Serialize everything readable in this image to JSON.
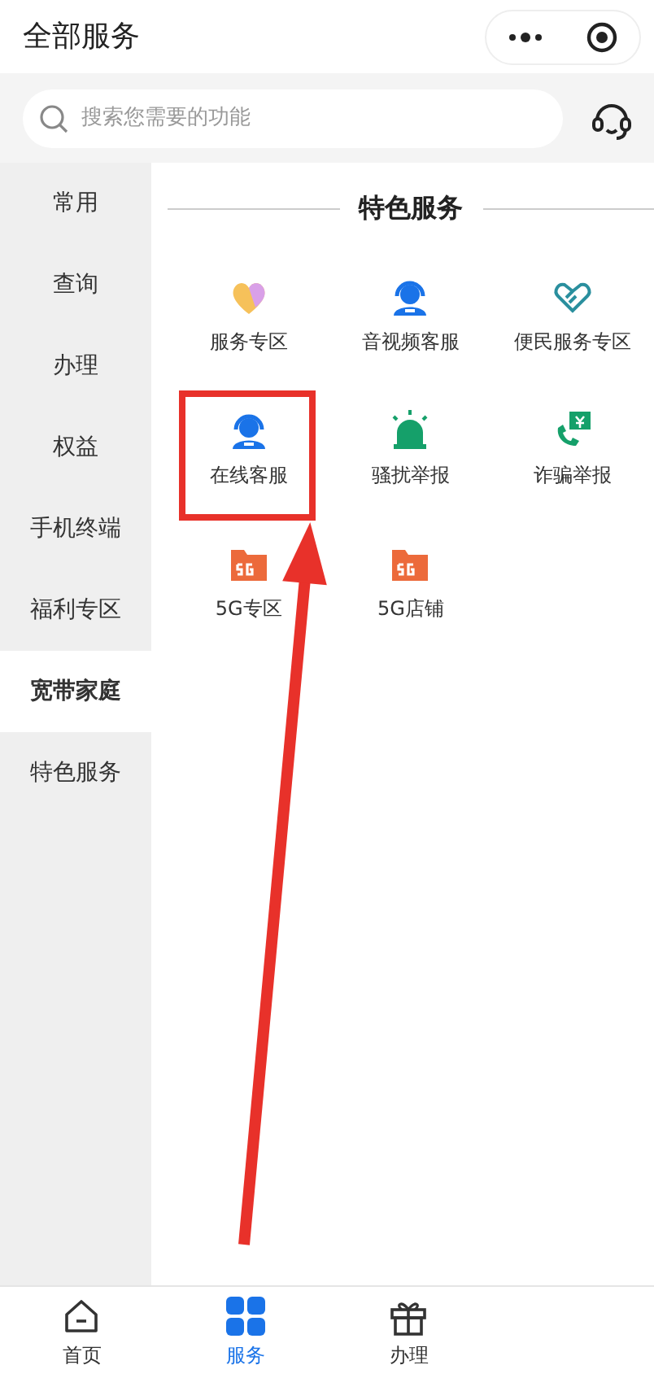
{
  "header": {
    "title": "全部服务"
  },
  "search": {
    "placeholder": "搜索您需要的功能"
  },
  "sidebar": {
    "items": [
      {
        "label": "常用",
        "selected": false
      },
      {
        "label": "查询",
        "selected": false
      },
      {
        "label": "办理",
        "selected": false
      },
      {
        "label": "权益",
        "selected": false
      },
      {
        "label": "手机终端",
        "selected": false
      },
      {
        "label": "福利专区",
        "selected": false
      },
      {
        "label": "宽带家庭",
        "selected": true
      },
      {
        "label": "特色服务",
        "selected": false
      }
    ]
  },
  "section": {
    "title": "特色服务",
    "items": [
      {
        "label": "服务专区",
        "kind": "heart",
        "highlighted": false
      },
      {
        "label": "音视频客服",
        "kind": "agent",
        "highlighted": false
      },
      {
        "label": "便民服务专区",
        "kind": "handshake",
        "highlighted": false
      },
      {
        "label": "在线客服",
        "kind": "agent",
        "highlighted": true
      },
      {
        "label": "骚扰举报",
        "kind": "alarm",
        "highlighted": false
      },
      {
        "label": "诈骗举报",
        "kind": "phone",
        "highlighted": false
      },
      {
        "label": "5G专区",
        "kind": "folder5g",
        "highlighted": false
      },
      {
        "label": "5G店铺",
        "kind": "folder5g",
        "highlighted": false
      }
    ]
  },
  "tabbar": [
    {
      "label": "首页",
      "kind": "home",
      "selected": false
    },
    {
      "label": "服务",
      "kind": "grid",
      "selected": true
    },
    {
      "label": "办理",
      "kind": "gift",
      "selected": false
    }
  ]
}
